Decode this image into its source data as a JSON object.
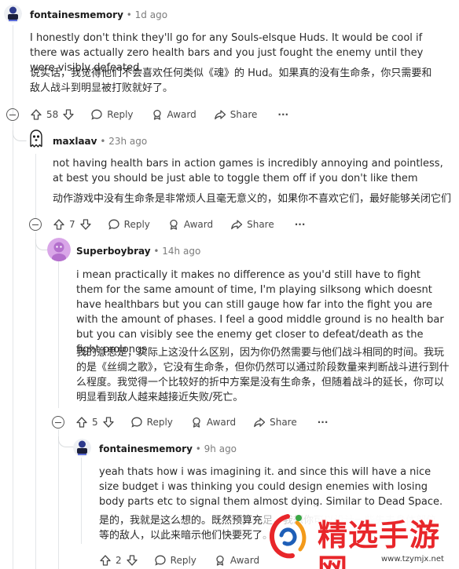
{
  "comments": [
    {
      "username": "fontainesmemory",
      "time": "1d ago",
      "text_en": "I honestly don't think they'll go for any Souls-elsque Huds. It would be cool if there was actually zero health bars and you just fought the enemy until they were visibly defeated.",
      "text_zh": "说实话，我觉得他们不会喜欢任何类似《魂》的 Hud。如果真的没有生命条，你只需要和敌人战斗到明显被打败就好了。",
      "votes": "58"
    },
    {
      "username": "maxlaav",
      "time": "23h ago",
      "text_en": "not having health bars in action games is incredibly annoying and pointless, at best you should be just able to toggle them off if you don't like them",
      "text_zh": "动作游戏中没有生命条是非常烦人且毫无意义的，如果你不喜欢它们，最好能够关闭它们",
      "votes": "7"
    },
    {
      "username": "Superboybray",
      "time": "14h ago",
      "text_en": "i mean practically it makes no difference as you'd still have to fight them for the same amount of time, I'm playing silksong which doesnt have healthbars but you can still gauge how far into the fight you are with the amount of phases. I feel a good middle ground is no health bar but you can visibly see the enemy get closer to defeat/death as the fight prolongs",
      "text_zh": "我的意思是，实际上这没什么区别，因为你仍然需要与他们战斗相同的时间。我玩的是《丝绸之歌》，它没有生命条，但你仍然可以通过阶段数量来判断战斗进行到什么程度。我觉得一个比较好的折中方案是没有生命条，但随着战斗的延长，你可以明显看到敌人越来越接近失败/死亡。",
      "votes": "5"
    },
    {
      "username": "fontainesmemory",
      "time": "9h ago",
      "text_en": "yeah thats how i was imagining it. and since this will have a nice size budget i was thinking you could design enemies with losing body parts etc to signal them almost dying. Similar to Dead Space.",
      "text_zh": "是的，我就是这么想的。既然预算充足，我想你可以设计一些失去身体部位等的敌人，以此来暗示他们快要死了。",
      "votes": "2"
    }
  ],
  "actions": {
    "reply": "Reply",
    "award": "Award",
    "share": "Share",
    "more": "···",
    "separator": "•"
  },
  "watermark": {
    "title": "精选手游网",
    "url": "www.tzymjx.net"
  },
  "colors": {
    "text": "#1c1c1c",
    "muted": "#7c7c7c",
    "thread": "#e3e6e8",
    "watermark_red": "#e8262a",
    "watermark_blue": "#1e5fb8"
  }
}
